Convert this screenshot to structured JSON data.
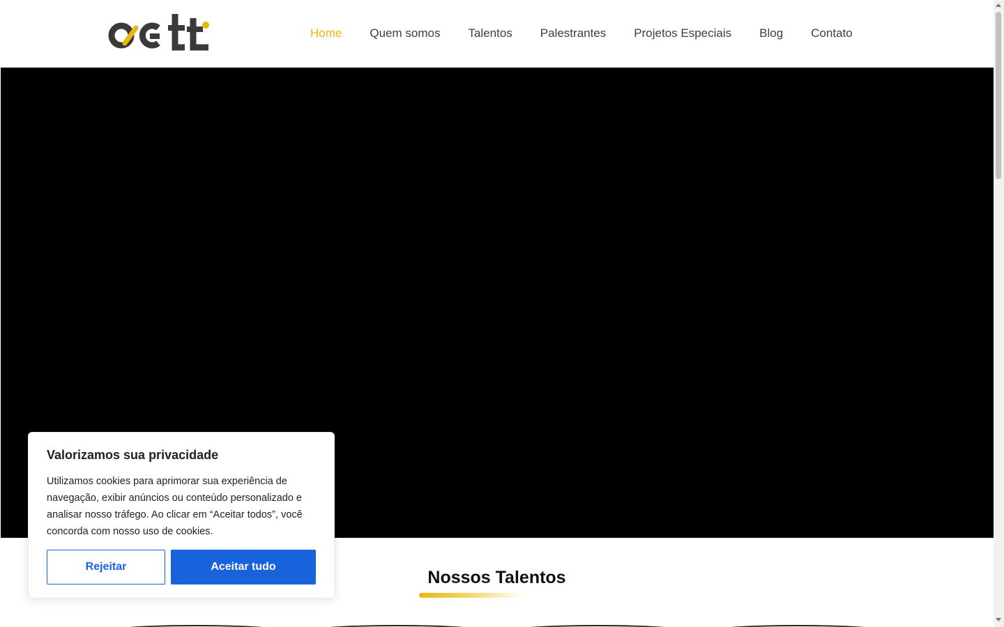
{
  "nav": {
    "items": [
      {
        "label": "Home",
        "active": true
      },
      {
        "label": "Quem somos"
      },
      {
        "label": "Talentos"
      },
      {
        "label": "Palestrantes"
      },
      {
        "label": "Projetos Especiais"
      },
      {
        "label": "Blog"
      },
      {
        "label": "Contato"
      }
    ]
  },
  "brand": {
    "logo_text": "agtt",
    "accent_color": "#e8b80e",
    "dark_color": "#3a3a3a"
  },
  "section": {
    "title": "Nossos Talentos"
  },
  "cookie": {
    "title": "Valorizamos sua privacidade",
    "text": "Utilizamos cookies para aprimorar sua experiência de navegação, exibir anúncios ou conteúdo personalizado e analisar nosso tráfego. Ao clicar em “Aceitar todos”, você concorda com nosso uso de cookies.",
    "reject_label": "Rejeitar",
    "accept_label": "Aceitar tudo",
    "button_color": "#1863dc"
  }
}
